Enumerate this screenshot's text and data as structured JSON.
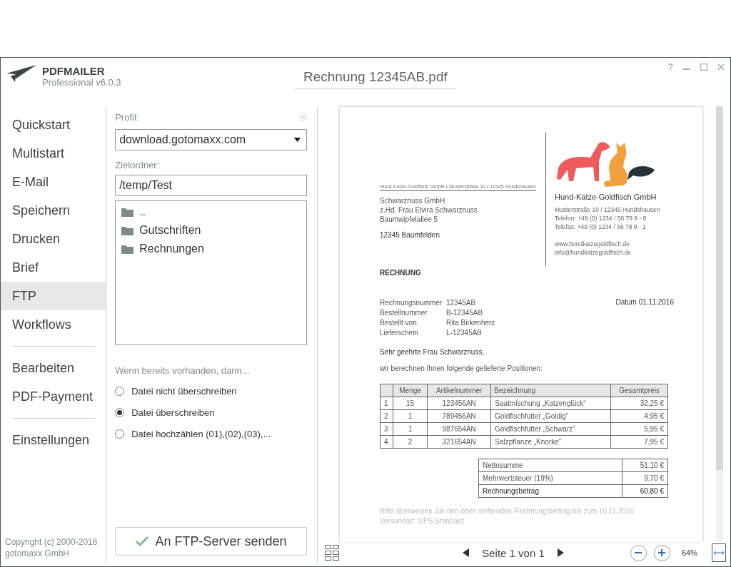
{
  "app": {
    "name": "PDFMAILER",
    "edition": "Professional v6.0.3"
  },
  "document_title": "Rechnung 12345AB.pdf",
  "help_label": "?",
  "sidebar": {
    "groups": [
      [
        {
          "label": "Quickstart",
          "selected": false
        },
        {
          "label": "Multistart",
          "selected": false
        },
        {
          "label": "E-Mail",
          "selected": false
        },
        {
          "label": "Speichern",
          "selected": false
        },
        {
          "label": "Drucken",
          "selected": false
        },
        {
          "label": "Brief",
          "selected": false
        },
        {
          "label": "FTP",
          "selected": true
        },
        {
          "label": "Workflows",
          "selected": false
        }
      ],
      [
        {
          "label": "Bearbeiten",
          "selected": false
        },
        {
          "label": "PDF-Payment",
          "selected": false
        }
      ],
      [
        {
          "label": "Einstellungen",
          "selected": false
        }
      ]
    ],
    "copyright": [
      "Copyright (c) 2000-2016",
      "gotomaxx GmbH"
    ]
  },
  "ftp": {
    "profile_label": "Profil:",
    "profile_value": "download.gotomaxx.com",
    "target_label": "Zielordner:",
    "target_value": "/temp/Test",
    "folders": [
      {
        "label": ".."
      },
      {
        "label": "Gutschriften"
      },
      {
        "label": "Rechnungen"
      }
    ],
    "exists_label": "Wenn bereits vorhanden, dann...",
    "options": [
      {
        "label": "Datei nicht überschreiben",
        "selected": false
      },
      {
        "label": "Datei überschreiben",
        "selected": true
      },
      {
        "label": "Datei hochzählen (01),(02),(03),...",
        "selected": false
      }
    ],
    "send_button": "An FTP-Server senden"
  },
  "letter": {
    "sender_line": "Hund-Katze-Goldfisch GmbH • Musterstraße 10 • 12345 Hundshausen",
    "recipient": [
      "Schwarznuss GmbH",
      "z.Hd. Frau Elvira Schwarznuss",
      "Baumwipfelallee 5"
    ],
    "city": "12345 Baumfelden",
    "company": "Hund-Katze-Goldfisch GmbH",
    "contact": [
      "Musterstraße 10 / 12345 Hundshausen",
      "Telefon: +49 (0) 1234 / 56 78 9 - 0",
      "Telefax: +49 (0) 1234 / 56 78 9 - 1"
    ],
    "web": [
      "www.hundkatzegoldfisch.de",
      "info@hundkatzegoldfisch.de"
    ],
    "heading": "RECHNUNG",
    "meta": [
      [
        "Rechnungsnummer",
        "12345AB"
      ],
      [
        "Bestellnummer",
        "B-12345AB"
      ],
      [
        "Bestellt von",
        "Rita Birkenherz"
      ],
      [
        "Lieferschein",
        "L-12345AB"
      ]
    ],
    "date": "Datum 01.11.2016",
    "greeting": "Sehr geehrte Frau Schwarznuss,",
    "intro": "wir berechnen Ihnen folgende gelieferte Positionen:",
    "columns": [
      "",
      "Menge",
      "Artikelnummer",
      "Bezeichnung",
      "Gesamtpreis"
    ],
    "rows": [
      [
        "1",
        "15",
        "123456AN",
        "Saatmischung „Katzenglück“",
        "32,25 €"
      ],
      [
        "2",
        "1",
        "789456AN",
        "Goldfischfutter „Goldig“",
        "4,95 €"
      ],
      [
        "3",
        "1",
        "987654AN",
        "Goldfischfutter „Schwarz“",
        "5,95 €"
      ],
      [
        "4",
        "2",
        "321654AN",
        "Salzpflanze „Knorke“",
        "7,95 €"
      ]
    ],
    "totals": [
      {
        "label": "Nettosumme",
        "value": "51,10 €",
        "total": false
      },
      {
        "label": "Mehrwertsteuer (19%)",
        "value": "9,70 €",
        "total": false
      },
      {
        "label": "Rechnungsbetrag",
        "value": "60,80 €",
        "total": true
      }
    ],
    "footer": [
      "Bitte überweisen Sie den oben stehenden Rechnungsbetrag bis zum 10.11.2016",
      "Versandart: UPS Standard"
    ]
  },
  "viewer": {
    "page_label": "Seite 1 von 1",
    "zoom": "64%"
  }
}
